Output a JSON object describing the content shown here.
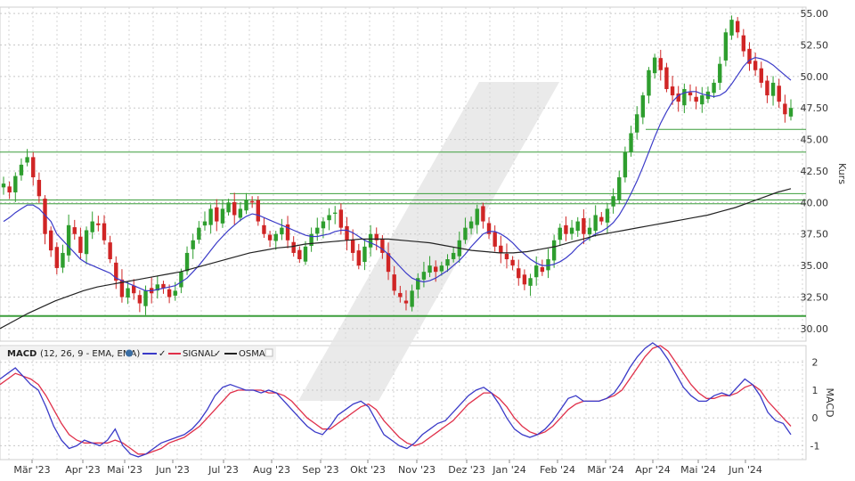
{
  "chart_data": [
    {
      "type": "candlestick",
      "ylabel": "Kurs",
      "ylim": [
        29.0,
        55.5
      ],
      "y_ticks": [
        "30.00",
        "32.50",
        "35.00",
        "37.50",
        "40.00",
        "42.50",
        "45.00",
        "47.50",
        "50.00",
        "52.50",
        "55.00"
      ],
      "x_ticks": [
        "Mär '23",
        "Apr '23",
        "Mai '23",
        "Jun '23",
        "Jul '23",
        "Aug '23",
        "Sep '23",
        "Okt '23",
        "Nov '23",
        "Dez '23",
        "Jan '24",
        "Feb '24",
        "Mär '24",
        "Apr '24",
        "Mai '24",
        "Jun '24"
      ],
      "colors": {
        "up": "#2e9e2e",
        "down": "#d02525",
        "sma_short": "#3a3ac8",
        "sma_long": "#222222",
        "level_lines": "#3c9e3c"
      },
      "series": [
        {
          "values": [
            41.5,
            40.8,
            42.1,
            43.0,
            43.6,
            42.0,
            40.5,
            37.5,
            36.2,
            34.8,
            36.0,
            38.2,
            37.5,
            36.0,
            37.8,
            38.5,
            38.2,
            37.0,
            35.5,
            33.8,
            32.5,
            33.2,
            32.8,
            32.0,
            33.0,
            32.8,
            33.5,
            33.2,
            32.5,
            33.0,
            34.5,
            36.0,
            37.0,
            38.0,
            38.5,
            39.5,
            38.5,
            39.5,
            40.0,
            39.0,
            39.5,
            40.2,
            40.0,
            38.5,
            37.5,
            37.0,
            37.5,
            38.0,
            37.0,
            36.0,
            35.5,
            36.5,
            37.5,
            38.0,
            38.5,
            39.0,
            39.2,
            38.0,
            37.0,
            36.0,
            35.0,
            36.5,
            37.5,
            37.0,
            36.0,
            34.5,
            33.0,
            32.5,
            32.0,
            33.0,
            34.0,
            34.5,
            35.0,
            34.5,
            35.0,
            35.5,
            36.0,
            37.0,
            38.0,
            38.5,
            39.5,
            38.5,
            37.5,
            36.5,
            36.0,
            35.5,
            35.0,
            34.0,
            33.5,
            34.0,
            35.0,
            34.5,
            35.5,
            37.0,
            38.0,
            37.5,
            38.0,
            38.5,
            37.5,
            38.0,
            39.0,
            38.5,
            39.5,
            40.5,
            42.0,
            44.0,
            45.5,
            47.0,
            48.5,
            50.5,
            51.5,
            50.5,
            49.0,
            48.5,
            48.0,
            49.0,
            48.5,
            48.0,
            48.5,
            48.8,
            49.5,
            51.0,
            53.5,
            54.5,
            53.5,
            52.0,
            51.0,
            50.5,
            49.5,
            48.5,
            49.5,
            48.0,
            47.0,
            47.5
          ]
        },
        {
          "values": [
            38.5,
            38.8,
            39.2,
            39.5,
            39.8,
            39.8,
            39.5,
            39.0,
            38.5,
            37.5,
            37.0,
            36.5,
            36.0,
            35.5,
            35.2,
            35.0,
            34.8,
            34.6,
            34.4,
            34.0,
            33.8,
            33.6,
            33.4,
            33.2,
            33.0,
            33.0,
            33.1,
            33.2,
            33.3,
            33.4,
            33.7,
            34.0,
            34.5,
            35.0,
            35.6,
            36.2,
            36.8,
            37.3,
            37.8,
            38.2,
            38.6,
            38.9,
            39.1,
            39.0,
            38.8,
            38.6,
            38.4,
            38.2,
            38.0,
            37.8,
            37.6,
            37.4,
            37.3,
            37.3,
            37.4,
            37.5,
            37.7,
            37.8,
            37.8,
            37.6,
            37.3,
            37.0,
            36.8,
            36.6,
            36.3,
            35.9,
            35.4,
            34.9,
            34.4,
            34.0,
            33.8,
            33.7,
            33.8,
            34.0,
            34.3,
            34.6,
            35.0,
            35.4,
            35.9,
            36.5,
            37.0,
            37.5,
            37.7,
            37.7,
            37.5,
            37.2,
            36.8,
            36.3,
            35.9,
            35.5,
            35.2,
            35.0,
            35.0,
            35.1,
            35.3,
            35.6,
            36.0,
            36.5,
            36.9,
            37.2,
            37.5,
            37.7,
            38.0,
            38.4,
            39.0,
            39.8,
            40.7,
            41.7,
            42.8,
            44.0,
            45.2,
            46.3,
            47.2,
            48.0,
            48.5,
            48.7,
            48.8,
            48.8,
            48.6,
            48.5,
            48.4,
            48.5,
            48.8,
            49.4,
            50.1,
            50.8,
            51.3,
            51.5,
            51.4,
            51.2,
            50.9,
            50.5,
            50.1,
            49.7
          ]
        },
        {
          "values": [
            30.0,
            30.6,
            31.2,
            31.7,
            32.2,
            32.6,
            33.0,
            33.3,
            33.5,
            33.7,
            33.9,
            34.1,
            34.3,
            34.5,
            34.8,
            35.1,
            35.4,
            35.7,
            36.0,
            36.2,
            36.4,
            36.5,
            36.7,
            36.8,
            36.9,
            37.0,
            37.1,
            37.1,
            37.1,
            37.0,
            36.9,
            36.8,
            36.6,
            36.4,
            36.2,
            36.1,
            36.0,
            36.0,
            36.1,
            36.3,
            36.5,
            36.8,
            37.1,
            37.4,
            37.6,
            37.8,
            38.0,
            38.2,
            38.4,
            38.6,
            38.8,
            39.0,
            39.3,
            39.6,
            40.0,
            40.4,
            40.8,
            41.1
          ]
        }
      ]
    },
    {
      "type": "line",
      "title": "MACD",
      "legend_params": "(12, 26, 9 - EMA, EMA)",
      "legend_entries": [
        "SIGNAL",
        "OSMA"
      ],
      "ylabel": "MACD",
      "ylim": [
        -1.5,
        2.6
      ],
      "y_ticks": [
        "2",
        "1",
        "0",
        "-1"
      ],
      "colors": {
        "macd": "#3a3ac8",
        "signal": "#e0304a",
        "osma": "#222222"
      },
      "series": [
        {
          "values": [
            1.4,
            1.6,
            1.8,
            1.5,
            1.2,
            1.0,
            0.4,
            -0.3,
            -0.8,
            -1.1,
            -1.0,
            -0.8,
            -0.9,
            -1.0,
            -0.8,
            -0.4,
            -1.0,
            -1.3,
            -1.4,
            -1.3,
            -1.1,
            -0.9,
            -0.8,
            -0.7,
            -0.6,
            -0.4,
            -0.1,
            0.3,
            0.8,
            1.1,
            1.2,
            1.1,
            1.0,
            1.0,
            0.9,
            1.0,
            0.9,
            0.6,
            0.3,
            0.0,
            -0.3,
            -0.5,
            -0.6,
            -0.3,
            0.1,
            0.3,
            0.5,
            0.6,
            0.4,
            -0.1,
            -0.6,
            -0.8,
            -1.0,
            -1.1,
            -0.9,
            -0.6,
            -0.4,
            -0.2,
            -0.1,
            0.2,
            0.5,
            0.8,
            1.0,
            1.1,
            0.9,
            0.5,
            0.0,
            -0.4,
            -0.6,
            -0.7,
            -0.6,
            -0.4,
            -0.1,
            0.3,
            0.7,
            0.8,
            0.6,
            0.6,
            0.6,
            0.7,
            0.9,
            1.3,
            1.8,
            2.2,
            2.5,
            2.7,
            2.5,
            2.1,
            1.6,
            1.1,
            0.8,
            0.6,
            0.6,
            0.8,
            0.9,
            0.8,
            1.1,
            1.4,
            1.2,
            0.8,
            0.2,
            -0.1,
            -0.2,
            -0.6
          ]
        },
        {
          "values": [
            1.2,
            1.4,
            1.6,
            1.5,
            1.4,
            1.2,
            0.8,
            0.3,
            -0.2,
            -0.6,
            -0.8,
            -0.9,
            -0.9,
            -0.9,
            -0.9,
            -0.8,
            -0.9,
            -1.1,
            -1.3,
            -1.3,
            -1.2,
            -1.1,
            -0.9,
            -0.8,
            -0.7,
            -0.5,
            -0.3,
            0.0,
            0.3,
            0.6,
            0.9,
            1.0,
            1.0,
            1.0,
            1.0,
            0.9,
            0.9,
            0.8,
            0.6,
            0.3,
            0.0,
            -0.2,
            -0.4,
            -0.4,
            -0.2,
            0.0,
            0.2,
            0.4,
            0.5,
            0.3,
            -0.1,
            -0.4,
            -0.7,
            -0.9,
            -1.0,
            -0.9,
            -0.7,
            -0.5,
            -0.3,
            -0.1,
            0.2,
            0.5,
            0.7,
            0.9,
            0.9,
            0.7,
            0.4,
            0.0,
            -0.3,
            -0.5,
            -0.6,
            -0.5,
            -0.3,
            0.0,
            0.3,
            0.5,
            0.6,
            0.6,
            0.6,
            0.7,
            0.8,
            1.0,
            1.4,
            1.8,
            2.2,
            2.5,
            2.6,
            2.4,
            2.0,
            1.6,
            1.2,
            0.9,
            0.7,
            0.7,
            0.8,
            0.8,
            0.9,
            1.1,
            1.2,
            1.0,
            0.6,
            0.3,
            0.0,
            -0.3
          ]
        }
      ]
    }
  ]
}
